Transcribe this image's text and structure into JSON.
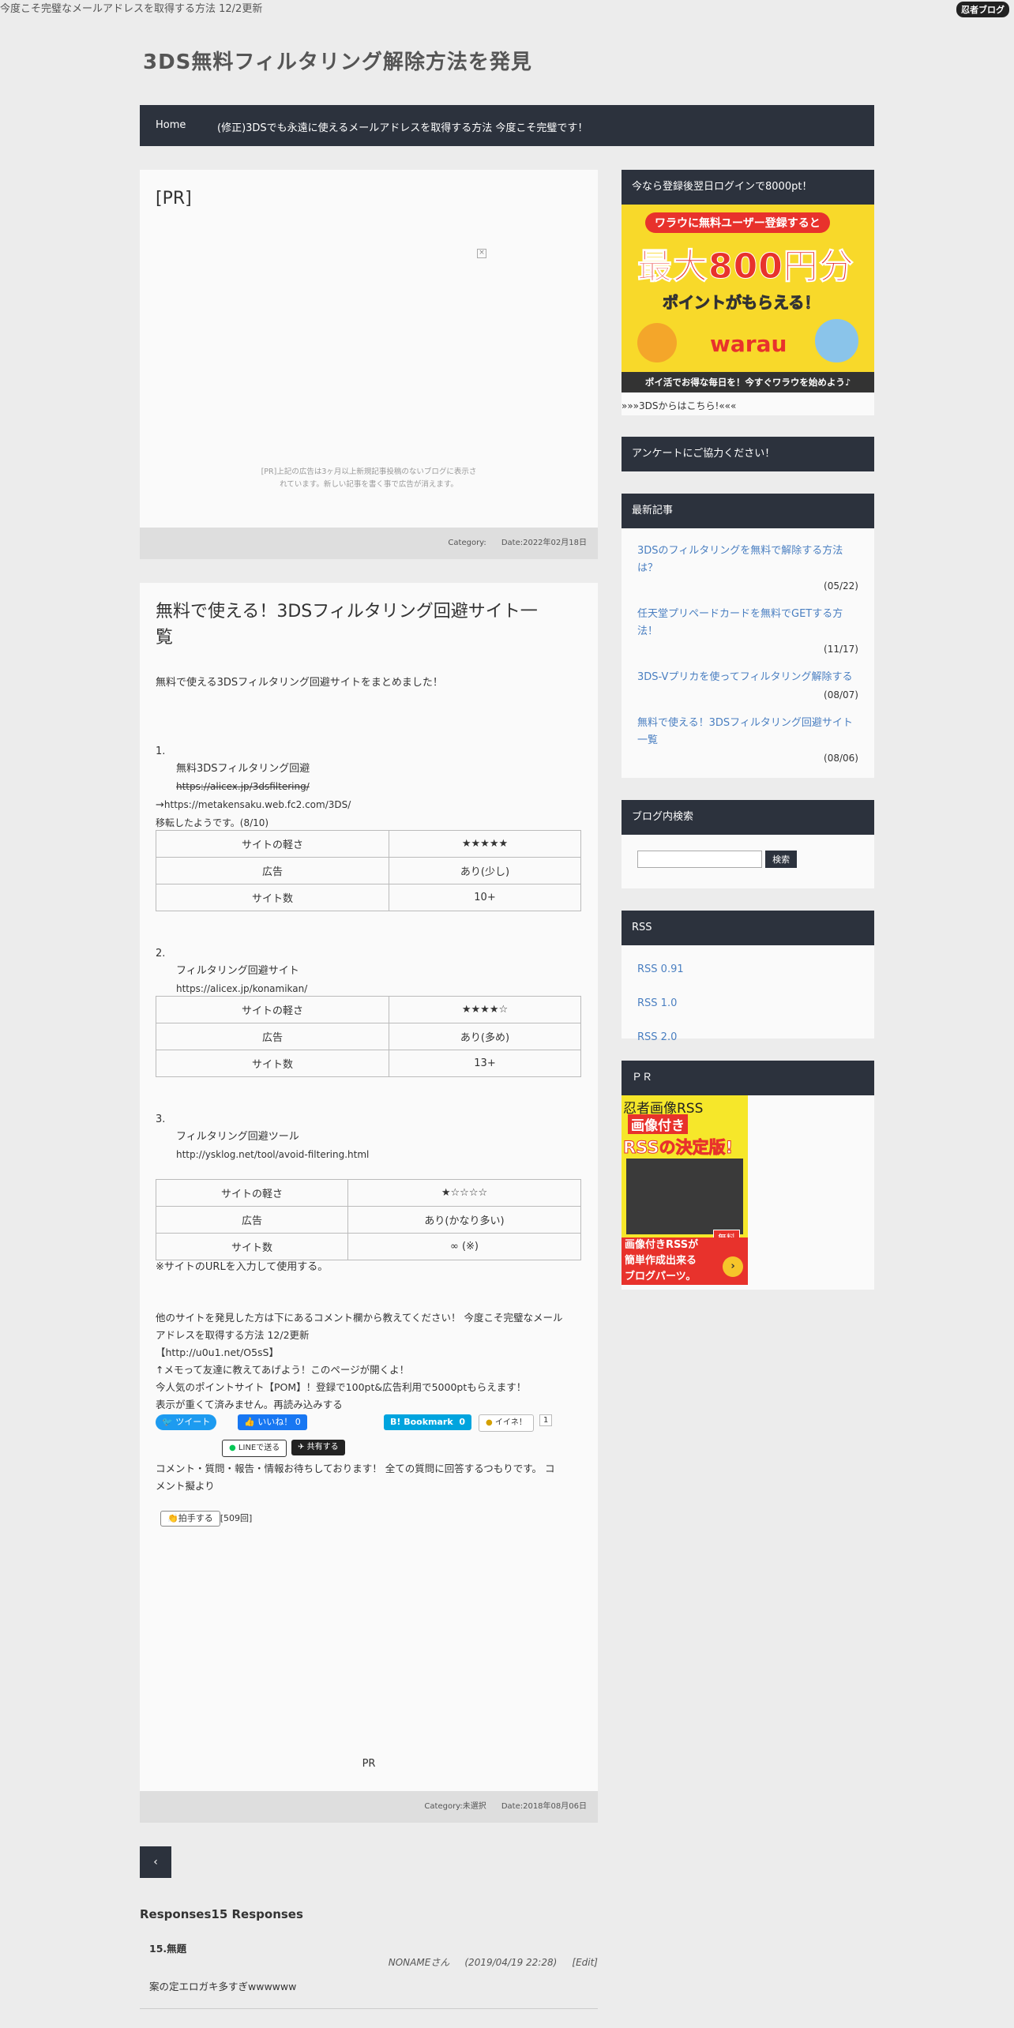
{
  "top": {
    "tagline": "今度こそ完璧なメールアドレスを取得する方法 12/2更新",
    "logo": "忍者ブログ"
  },
  "header": {
    "site_title": "3DS無料フィルタリング解除方法を発見"
  },
  "nav": {
    "items": [
      "Home",
      "(修正)3DSでも永遠に使えるメールアドレスを取得する方法 今度こそ完璧です！"
    ]
  },
  "pr_post": {
    "title": "[PR]",
    "ad_notice_1": "[PR]上記の広告は3ヶ月以上新規記事投稿のないブログに表示さ",
    "ad_notice_2": "れています。新しい記事を書く事で広告が消えます。",
    "footer_category": "Category:",
    "footer_date": "Date:2022年02月18日"
  },
  "post": {
    "title_line1": "無料で使える！3DSフィルタリング回避サイト一",
    "title_line2": "覧",
    "intro": "無料で使える3DSフィルタリング回避サイトをまとめました！",
    "items": [
      {
        "num": "1.",
        "name": "無料3DSフィルタリング回避",
        "url_old": "https://alicex.jp/3dsfiltering/",
        "arrow": "→",
        "url_new": "https://metakensaku.web.fc2.com/3DS/",
        "note": "移転したようです。(8/10)",
        "rows": [
          [
            "サイトの軽さ",
            "★★★★★"
          ],
          [
            "広告",
            "あり(少し)"
          ],
          [
            "サイト数",
            "10+"
          ]
        ]
      },
      {
        "num": "2.",
        "name": "フィルタリング回避サイト",
        "url": "https://alicex.jp/konamikan/",
        "rows": [
          [
            "サイトの軽さ",
            "★★★★☆"
          ],
          [
            "広告",
            "あり(多め)"
          ],
          [
            "サイト数",
            "13+"
          ]
        ]
      },
      {
        "num": "3.",
        "name": "フィルタリング回避ツール",
        "url": "http://ysklog.net/tool/avoid-filtering.html",
        "rows": [
          [
            "サイトの軽さ",
            "★☆☆☆☆"
          ],
          [
            "広告",
            "あり(かなり多い)"
          ],
          [
            "サイト数",
            "∞ (※)"
          ]
        ],
        "note": "※サイトのURLを入力して使用する。"
      }
    ],
    "other_line1": "他のサイトを発見した方は下にあるコメント欄から教えてください！",
    "other_link": "今度こそ完璧なメール",
    "other_link2": "アドレスを取得する方法 12/2更新",
    "short_url": "【http://u0u1.net/O5sS】",
    "memo": "↑メモって友達に教えてあげよう！このページが開くよ！",
    "promo_link": "今人気のポイントサイト【POM】！登録で100pt&広告利用で5000ptもらえます！",
    "slow_text": "表示が重くて済みません。",
    "slow_link": "再読み込みする",
    "tweet": "ツイート",
    "like": "いいね！ 0",
    "bookmark": "B! Bookmark",
    "bookmark_count": "0",
    "iine": "イイネ！",
    "iine_count": "1",
    "line_btn": "LINEで送る",
    "share_btn": "共有する",
    "comment_line1": "コメント・質問・報告・情報お待ちしております！ 全ての質問に回答するつもりです。 コ",
    "comment_line2": "メント擬より",
    "clap_btn": "拍手する",
    "clap_count": "[509回]",
    "pr_label": "PR",
    "footer_category": "Category:未選択",
    "footer_date": "Date:2018年08月06日"
  },
  "pager": {
    "prev": "‹"
  },
  "responses": {
    "heading": "Responses15 Responses",
    "items": [
      {
        "title": "15.無題",
        "author": "NONAMEさん",
        "date": "(2019/04/19 22:28)",
        "edit": "[Edit]",
        "body": "案の定エロガキ多すぎwwwwww"
      }
    ]
  },
  "sidebar": {
    "w1_title": "今なら登録後翌日ログインで8000pt！",
    "w1_banner_1": "ワラウに無料ユーザー登録すると",
    "w1_banner_2": "最大800円分",
    "w1_banner_3": "ポイントがもらえる！",
    "w1_banner_4": "ポイ活でお得な毎日を！今すぐワラウを始めよう♪",
    "w1_banner_logo": "warau",
    "w1_link": "»»»3DSからはこちら!«««",
    "w2_title": "アンケートにご協力ください！",
    "w3_title": "最新記事",
    "articles": [
      {
        "title": "3DSのフィルタリングを無料で解除する方法は？",
        "date": "(05/22)"
      },
      {
        "title": "任天堂プリペードカードを無料でGETする方法！",
        "date": "(11/17)"
      },
      {
        "title": "3DS-Vプリカを使ってフィルタリング解除する",
        "date": "(08/07)"
      },
      {
        "title": "無料で使える！3DSフィルタリング回避サイト一覧",
        "date": "(08/06)"
      }
    ],
    "w4_title": "ブログ内検索",
    "search_btn": "検索",
    "w5_title": "RSS",
    "rss": [
      "RSS 0.91",
      "RSS 1.0",
      "RSS 2.0"
    ],
    "w6_title": "ＰＲ",
    "pr_banner_1": "忍者画像RSS",
    "pr_banner_2": "画像付き",
    "pr_banner_3": "RSSの決定版!",
    "pr_banner_4": "画像付きRSSが",
    "pr_banner_5": "簡単作成出来る",
    "pr_banner_6": "ブログパーツ。",
    "pr_banner_free": "無料"
  }
}
